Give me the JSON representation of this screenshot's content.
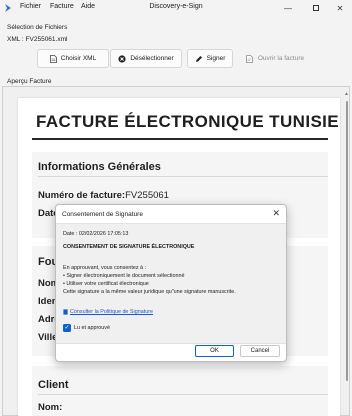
{
  "window": {
    "title": "Discovery-e-Sign",
    "menu": [
      "Fichier",
      "Facture",
      "Aide"
    ]
  },
  "file_selection": {
    "group_label": "Sélection de Fichiers",
    "current_file": "XML : FV255061.xml",
    "buttons": {
      "choose_xml": "Choisir XML",
      "deselect": "Désélectionner",
      "sign": "Signer",
      "open_invoice": "Ouvrir la facture"
    }
  },
  "preview": {
    "label": "Aperçu Facture",
    "doc_title": "FACTURE ÉLECTRONIQUE TUNISIENNE",
    "general": {
      "heading": "Informations Générales",
      "invoice_number_label": "Numéro de facture:",
      "invoice_number_value": "FV255061",
      "date_label": "Date"
    },
    "supplier": {
      "heading": "Fou",
      "fields": [
        "Nom",
        "Iden",
        "Adre",
        "Ville"
      ]
    },
    "client": {
      "heading": "Client",
      "name_label": "Nom:"
    }
  },
  "dialog": {
    "title": "Consentement de Signature",
    "date_line": "Date : 02/02/2026 17:05:13",
    "heading": "CONSENTEMENT DE SIGNATURE ÉLECTRONIQUE",
    "intro": "En approuvant, vous consentez à :",
    "bullet1": "• Signer électroniquement le document sélectionné",
    "bullet2": "• Utiliser votre certificat électronique",
    "legal": "Cette signature a la même valeur juridique qu\"une signature manuscrite.",
    "policy_link": "Consulter la Politique de Signature",
    "checkbox_label": "Lu et approuvé",
    "checkbox_checked": true,
    "ok_label": "OK",
    "cancel_label": "Cancel"
  },
  "colors": {
    "accent": "#0a64c8",
    "link": "#1a58c6",
    "window_bg": "#f3f3f3",
    "app_icon": "#3b6fd6"
  }
}
